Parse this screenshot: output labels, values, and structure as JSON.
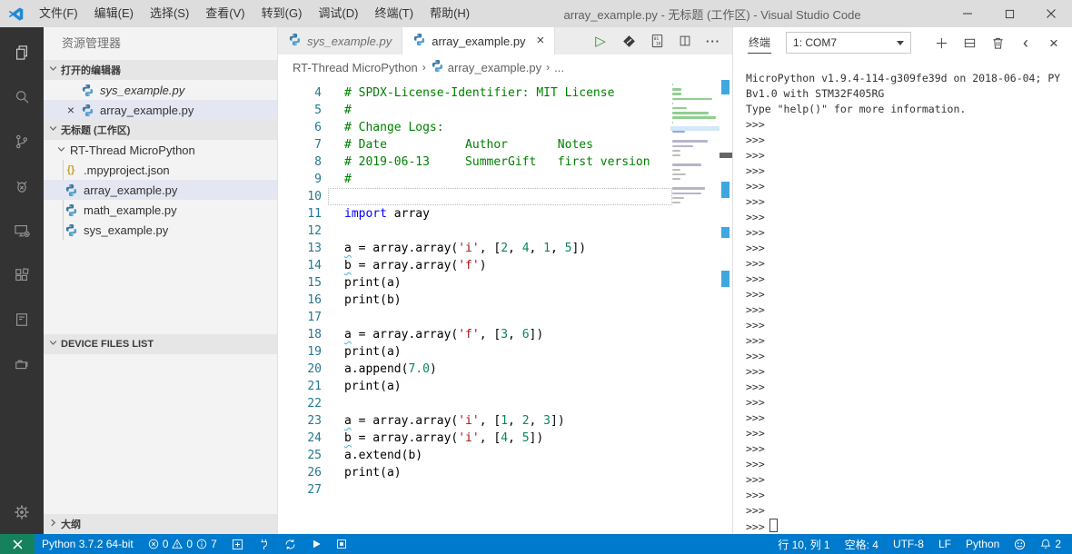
{
  "title_bar": {
    "menus": [
      "文件(F)",
      "编辑(E)",
      "选择(S)",
      "查看(V)",
      "转到(G)",
      "调试(D)",
      "终端(T)",
      "帮助(H)"
    ],
    "title": "array_example.py - 无标题 (工作区) - Visual Studio Code",
    "controls": [
      "minimize",
      "maximize",
      "close"
    ]
  },
  "activity_bar": {
    "items": [
      {
        "name": "explorer-icon",
        "active": true
      },
      {
        "name": "search-icon"
      },
      {
        "name": "source-control-icon"
      },
      {
        "name": "debug-icon"
      },
      {
        "name": "remote-device-icon"
      },
      {
        "name": "extensions-icon"
      },
      {
        "name": "notebook-icon"
      },
      {
        "name": "folders-icon"
      }
    ],
    "bottom_items": [
      {
        "name": "settings-gear-icon"
      }
    ]
  },
  "sidebar": {
    "title": "资源管理器",
    "open_editors": {
      "header": "打开的编辑器",
      "items": [
        {
          "label": "sys_example.py",
          "icon": "python-icon",
          "italic": true
        },
        {
          "label": "array_example.py",
          "icon": "python-icon",
          "selected": true,
          "close_glyph": "×"
        }
      ]
    },
    "workspace": {
      "header": "无标题 (工作区)",
      "root": {
        "label": "RT-Thread MicroPython",
        "expanded": true
      },
      "children": [
        {
          "label": ".mpyproject.json",
          "icon": "json-icon"
        },
        {
          "label": "array_example.py",
          "icon": "python-icon",
          "selected": true
        },
        {
          "label": "math_example.py",
          "icon": "python-icon"
        },
        {
          "label": "sys_example.py",
          "icon": "python-icon"
        }
      ]
    },
    "device_files": {
      "header": "DEVICE FILES LIST",
      "expanded": true
    },
    "outline": {
      "header": "大纲",
      "expanded": false
    }
  },
  "editor": {
    "tabs": [
      {
        "label": "sys_example.py",
        "icon": "python-icon",
        "italic": true,
        "active": false
      },
      {
        "label": "array_example.py",
        "icon": "python-icon",
        "active": true,
        "close_glyph": "×"
      }
    ],
    "actions": [
      {
        "name": "run-file-icon"
      },
      {
        "name": "rtthread-icon"
      },
      {
        "name": "binary-view-icon"
      },
      {
        "name": "split-editor-icon"
      },
      {
        "name": "more-actions-icon"
      }
    ],
    "breadcrumb": [
      {
        "label": "RT-Thread MicroPython"
      },
      {
        "label": "array_example.py",
        "icon": "python-icon"
      },
      {
        "label": "..."
      }
    ],
    "code": {
      "lines": [
        {
          "n": 4,
          "t": [
            {
              "s": "# SPDX-License-Identifier: MIT License",
              "c": "com"
            }
          ]
        },
        {
          "n": 5,
          "t": [
            {
              "s": "#",
              "c": "com"
            }
          ]
        },
        {
          "n": 6,
          "t": [
            {
              "s": "# Change Logs:",
              "c": "com"
            }
          ]
        },
        {
          "n": 7,
          "t": [
            {
              "s": "# Date           Author       Notes",
              "c": "com"
            }
          ]
        },
        {
          "n": 8,
          "t": [
            {
              "s": "# 2019-06-13     SummerGift   first version",
              "c": "com"
            }
          ]
        },
        {
          "n": 9,
          "t": [
            {
              "s": "#",
              "c": "com"
            }
          ]
        },
        {
          "n": 10,
          "t": [],
          "current": true
        },
        {
          "n": 11,
          "t": [
            {
              "s": "import",
              "c": "kw"
            },
            {
              "s": " array"
            }
          ]
        },
        {
          "n": 12,
          "t": []
        },
        {
          "n": 13,
          "t": [
            {
              "s": "a",
              "c": "sq"
            },
            {
              "s": " = array.array("
            },
            {
              "s": "'i'",
              "c": "str"
            },
            {
              "s": ", ["
            },
            {
              "s": "2",
              "c": "num"
            },
            {
              "s": ", "
            },
            {
              "s": "4",
              "c": "num"
            },
            {
              "s": ", "
            },
            {
              "s": "1",
              "c": "num"
            },
            {
              "s": ", "
            },
            {
              "s": "5",
              "c": "num"
            },
            {
              "s": "])"
            }
          ]
        },
        {
          "n": 14,
          "t": [
            {
              "s": "b",
              "c": "sq"
            },
            {
              "s": " = array.array("
            },
            {
              "s": "'f'",
              "c": "str"
            },
            {
              "s": ")"
            }
          ]
        },
        {
          "n": 15,
          "t": [
            {
              "s": "print(a)"
            }
          ]
        },
        {
          "n": 16,
          "t": [
            {
              "s": "print(b)"
            }
          ]
        },
        {
          "n": 17,
          "t": []
        },
        {
          "n": 18,
          "t": [
            {
              "s": "a",
              "c": "sq"
            },
            {
              "s": " = array.array("
            },
            {
              "s": "'f'",
              "c": "str"
            },
            {
              "s": ", ["
            },
            {
              "s": "3",
              "c": "num"
            },
            {
              "s": ", "
            },
            {
              "s": "6",
              "c": "num"
            },
            {
              "s": "])"
            }
          ]
        },
        {
          "n": 19,
          "t": [
            {
              "s": "print(a)"
            }
          ]
        },
        {
          "n": 20,
          "t": [
            {
              "s": "a.append("
            },
            {
              "s": "7.0",
              "c": "num"
            },
            {
              "s": ")"
            }
          ]
        },
        {
          "n": 21,
          "t": [
            {
              "s": "print(a)"
            }
          ]
        },
        {
          "n": 22,
          "t": []
        },
        {
          "n": 23,
          "t": [
            {
              "s": "a",
              "c": "sq"
            },
            {
              "s": " = array.array("
            },
            {
              "s": "'i'",
              "c": "str"
            },
            {
              "s": ", ["
            },
            {
              "s": "1",
              "c": "num"
            },
            {
              "s": ", "
            },
            {
              "s": "2",
              "c": "num"
            },
            {
              "s": ", "
            },
            {
              "s": "3",
              "c": "num"
            },
            {
              "s": "])"
            }
          ]
        },
        {
          "n": 24,
          "t": [
            {
              "s": "b",
              "c": "sq"
            },
            {
              "s": " = array.array("
            },
            {
              "s": "'i'",
              "c": "str"
            },
            {
              "s": ", ["
            },
            {
              "s": "4",
              "c": "num"
            },
            {
              "s": ", "
            },
            {
              "s": "5",
              "c": "num"
            },
            {
              "s": "])"
            }
          ]
        },
        {
          "n": 25,
          "t": [
            {
              "s": "a.extend(b)"
            }
          ]
        },
        {
          "n": 26,
          "t": [
            {
              "s": "print(a)"
            }
          ]
        },
        {
          "n": 27,
          "t": []
        }
      ]
    }
  },
  "terminal": {
    "tab": "终端",
    "dropdown_value": "1: COM7",
    "actions": [
      {
        "name": "plus-icon"
      },
      {
        "name": "split-terminal-icon"
      },
      {
        "name": "trash-icon"
      },
      {
        "name": "chevron-left-icon"
      },
      {
        "name": "close-panel-icon"
      }
    ],
    "banner": [
      "MicroPython v1.9.4-114-g309fe39d on 2018-06-04; PY",
      "Bv1.0 with STM32F405RG",
      "Type \"help()\" for more information."
    ],
    "prompt": ">>>",
    "prompt_count": 27,
    "cursor_on_last": true
  },
  "status_bar": {
    "left": [
      {
        "type": "remote",
        "icon": "remote-icon"
      },
      {
        "type": "text",
        "label": "Python 3.7.2 64-bit"
      },
      {
        "type": "problems",
        "errors": "0",
        "warnings": "0",
        "infos": "7"
      },
      {
        "type": "icon",
        "icon": "new-project-icon"
      },
      {
        "type": "icon",
        "icon": "plug-icon"
      },
      {
        "type": "icon",
        "icon": "sync-icon"
      },
      {
        "type": "icon",
        "icon": "run-icon"
      },
      {
        "type": "icon",
        "icon": "stop-icon"
      }
    ],
    "right": [
      {
        "type": "text",
        "label": "行 10, 列 1"
      },
      {
        "type": "text",
        "label": "空格: 4"
      },
      {
        "type": "text",
        "label": "UTF-8"
      },
      {
        "type": "text",
        "label": "LF"
      },
      {
        "type": "text",
        "label": "Python"
      },
      {
        "type": "icon",
        "icon": "smiley-icon"
      },
      {
        "type": "bell",
        "icon": "bell-icon",
        "count": "2"
      }
    ]
  },
  "colors": {
    "accent": "#007ACC",
    "remote_green": "#16825D",
    "activity_bar": "#333333",
    "comment": "#008000",
    "keyword": "#0000FF",
    "string": "#A31515",
    "number": "#098658",
    "selection_row": "#E4E6F1"
  }
}
